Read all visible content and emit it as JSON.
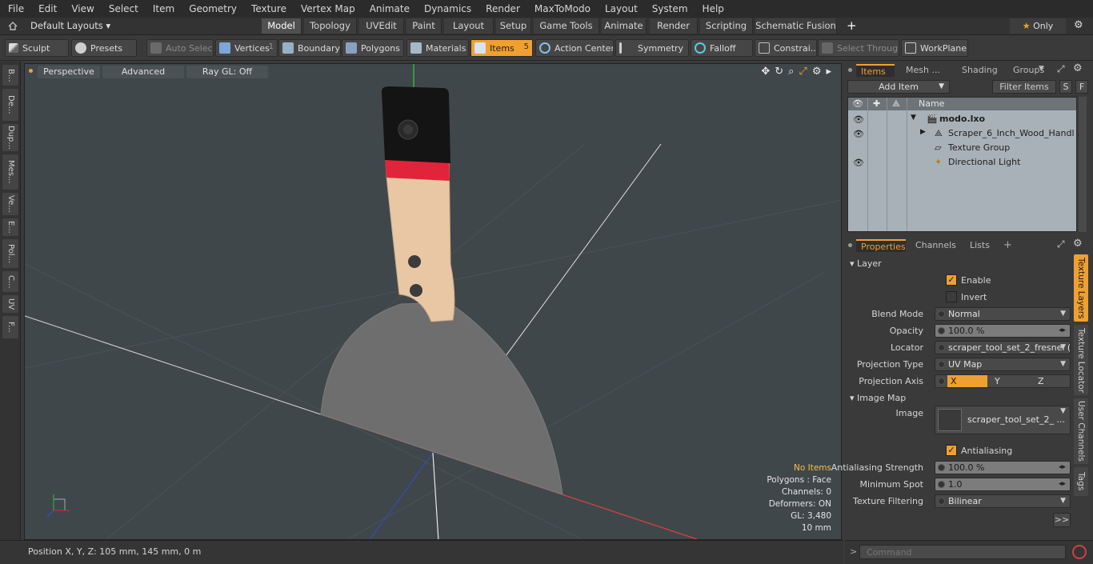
{
  "menu": [
    "File",
    "Edit",
    "View",
    "Select",
    "Item",
    "Geometry",
    "Texture",
    "Vertex Map",
    "Animate",
    "Dynamics",
    "Render",
    "MaxToModo",
    "Layout",
    "System",
    "Help"
  ],
  "layout_selector": "Default Layouts",
  "layout_tabs": [
    "Model",
    "Topology",
    "UVEdit",
    "Paint",
    "Layout",
    "Setup",
    "Game Tools",
    "Animate",
    "Render",
    "Scripting",
    "Schematic Fusion"
  ],
  "only_label": "Only",
  "toolbar": {
    "sculpt": "Sculpt",
    "presets": "Presets",
    "auto_select": "Auto Select",
    "vertices": "Vertices",
    "vertices_count": "1",
    "boundary": "Boundary",
    "polygons": "Polygons",
    "materials": "Materials",
    "items": "Items",
    "items_count": "5",
    "action_center": "Action Center",
    "symmetry": "Symmetry",
    "falloff": "Falloff",
    "constraints": "Constrai...",
    "select_through": "Select Through",
    "workplane": "WorkPlane"
  },
  "left_tabs": [
    "B...",
    "De...",
    "Dup...",
    "Mes...",
    "Ve...",
    "E...",
    "Pol...",
    "C...",
    "UV",
    "F..."
  ],
  "viewport": {
    "view_mode": "Perspective",
    "shading": "Advanced",
    "raygl": "Ray GL: Off",
    "hud": {
      "no_items": "No Items",
      "polygons": "Polygons : Face",
      "channels": "Channels: 0",
      "deformers": "Deformers: ON",
      "gl": "GL: 3,480",
      "unit": "10 mm"
    }
  },
  "status": {
    "position": "Position X, Y, Z:   105 mm, 145 mm, 0 m"
  },
  "items_panel": {
    "tabs": [
      "Items",
      "Mesh ...",
      "Shading",
      "Groups"
    ],
    "add_item": "Add Item",
    "filter_items": "Filter Items",
    "btn_s": "S",
    "btn_f": "F",
    "column_name": "Name",
    "rows": [
      {
        "label": "modo.lxo"
      },
      {
        "label": "Scraper_6_Inch_Wood_Handl ..."
      },
      {
        "label": "Texture Group"
      },
      {
        "label": "Directional Light"
      }
    ]
  },
  "props_panel": {
    "tabs": [
      "Properties",
      "Channels",
      "Lists"
    ],
    "layer_section": "Layer",
    "enable": "Enable",
    "invert": "Invert",
    "blend_mode_label": "Blend Mode",
    "blend_mode": "Normal",
    "opacity_label": "Opacity",
    "opacity": "100.0 %",
    "locator_label": "Locator",
    "locator": "scraper_tool_set_2_fresnel ( ...",
    "projection_type_label": "Projection Type",
    "projection_type": "UV Map",
    "projection_axis_label": "Projection Axis",
    "axis_x": "X",
    "axis_y": "Y",
    "axis_z": "Z",
    "image_map_section": "Image Map",
    "image_label": "Image",
    "image": "scraper_tool_set_2_ ...",
    "antialiasing": "Antialiasing",
    "aa_strength_label": "Antialiasing Strength",
    "aa_strength": "100.0 %",
    "min_spot_label": "Minimum Spot",
    "min_spot": "1.0",
    "tex_filter_label": "Texture Filtering",
    "tex_filter": "Bilinear",
    "more": ">>",
    "right_tabs": [
      "Texture Layers",
      "Texture Locator",
      "User Channels",
      "Tags"
    ]
  },
  "command": {
    "placeholder": "Command",
    "prompt": ">"
  },
  "colors": {
    "accent": "#f0a030",
    "viewport_bg": "#3f474b"
  }
}
